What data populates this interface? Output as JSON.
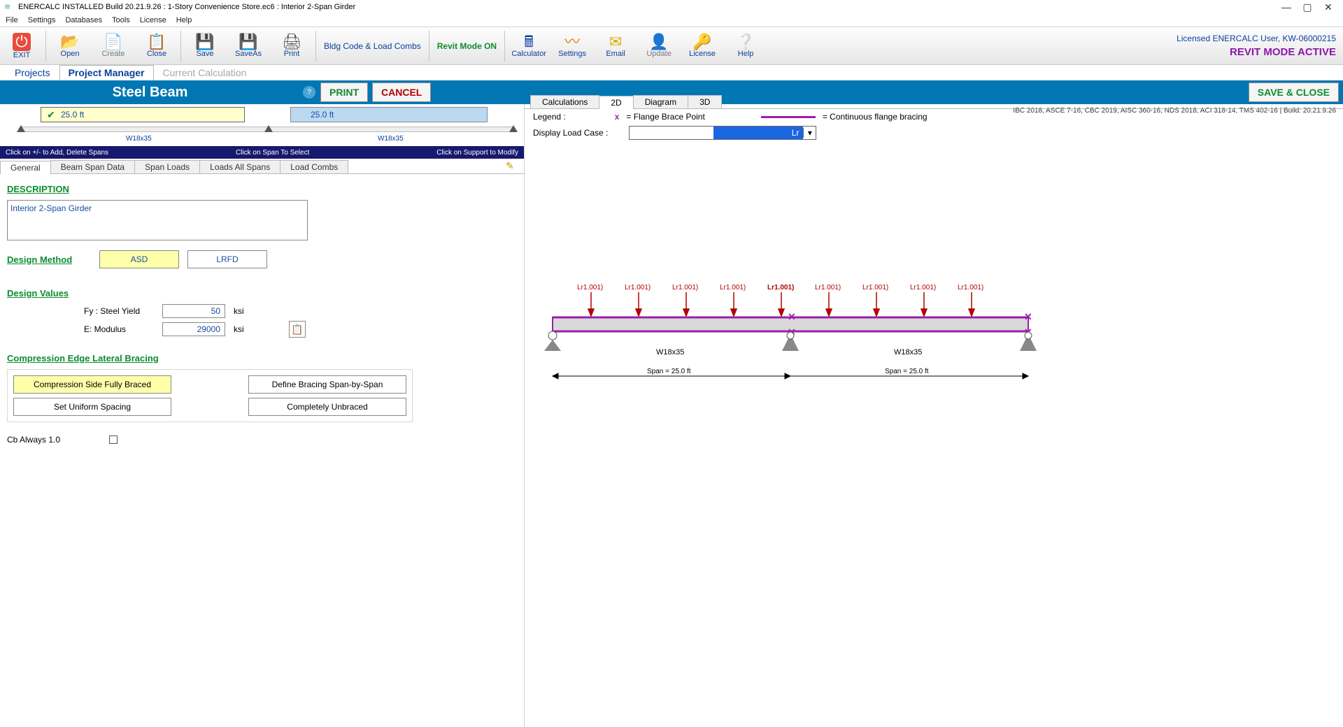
{
  "window": {
    "title": "ENERCALC INSTALLED Build 20.21.9.26 :  1-Story Convenience Store.ec6 : Interior 2-Span Girder",
    "min": "—",
    "max": "▢",
    "close": "✕"
  },
  "menu": [
    "File",
    "Settings",
    "Databases",
    "Tools",
    "License",
    "Help"
  ],
  "toolbar": {
    "exit": "EXIT",
    "open": "Open",
    "create": "Create",
    "close": "Close",
    "save": "Save",
    "saveas": "SaveAs",
    "print": "Print",
    "bldg": "Bldg Code & Load Combs",
    "revit": "Revit Mode ON",
    "calc": "Calculator",
    "settings": "Settings",
    "email": "Email",
    "update": "Update",
    "license": "License",
    "help": "Help",
    "licensed": "Licensed ENERCALC User, KW-06000215",
    "revit_active": "REVIT MODE ACTIVE"
  },
  "nav": {
    "projects": "Projects",
    "pm": "Project Manager",
    "cc": "Current Calculation"
  },
  "hdr": {
    "title": "Steel Beam",
    "print": "PRINT",
    "cancel": "CANCEL",
    "save": "SAVE & CLOSE"
  },
  "spans": {
    "s1": "25.0 ft",
    "s2": "25.0 ft",
    "label": "W18x35"
  },
  "instr": {
    "l": "Click on  +/-  to Add, Delete Spans",
    "c": "Click on Span To Select",
    "r": "Click on Support to Modify"
  },
  "innerTabs": [
    "General",
    "Beam Span Data",
    "Span Loads",
    "Loads All Spans",
    "Load Combs"
  ],
  "form": {
    "desc_h": "DESCRIPTION",
    "desc": "Interior 2-Span Girder",
    "dm_h": "Design Method",
    "asd": "ASD",
    "lrfd": "LRFD",
    "dv_h": "Design Values",
    "fy_l": "Fy : Steel Yield",
    "fy_v": "50",
    "fy_u": "ksi",
    "e_l": "E: Modulus",
    "e_v": "29000",
    "e_u": "ksi",
    "br_h": "Compression Edge Lateral Bracing",
    "b1": "Compression Side Fully Braced",
    "b2": "Define Bracing Span-by-Span",
    "b3": "Set Uniform Spacing",
    "b4": "Completely Unbraced",
    "cb": "Cb Always 1.0"
  },
  "right": {
    "codes": "IBC 2018, ASCE 7-16, CBC 2019, AISC 360-16, NDS 2018, ACI 318-14, TMS 402-16 | Build: 20.21.9.26",
    "tabs": [
      "Calculations",
      "2D",
      "Diagram",
      "3D"
    ],
    "legend_l": "Legend :",
    "legend_x": "x",
    "legend_fbp": "= Flange Brace Point",
    "legend_cfb": "= Continuous flange bracing",
    "dlc": "Display Load Case :",
    "dlc_val": "Lr",
    "load_lbl": "Lr1.001)",
    "beam": "W18x35",
    "span": "Span = 25.0 ft"
  }
}
